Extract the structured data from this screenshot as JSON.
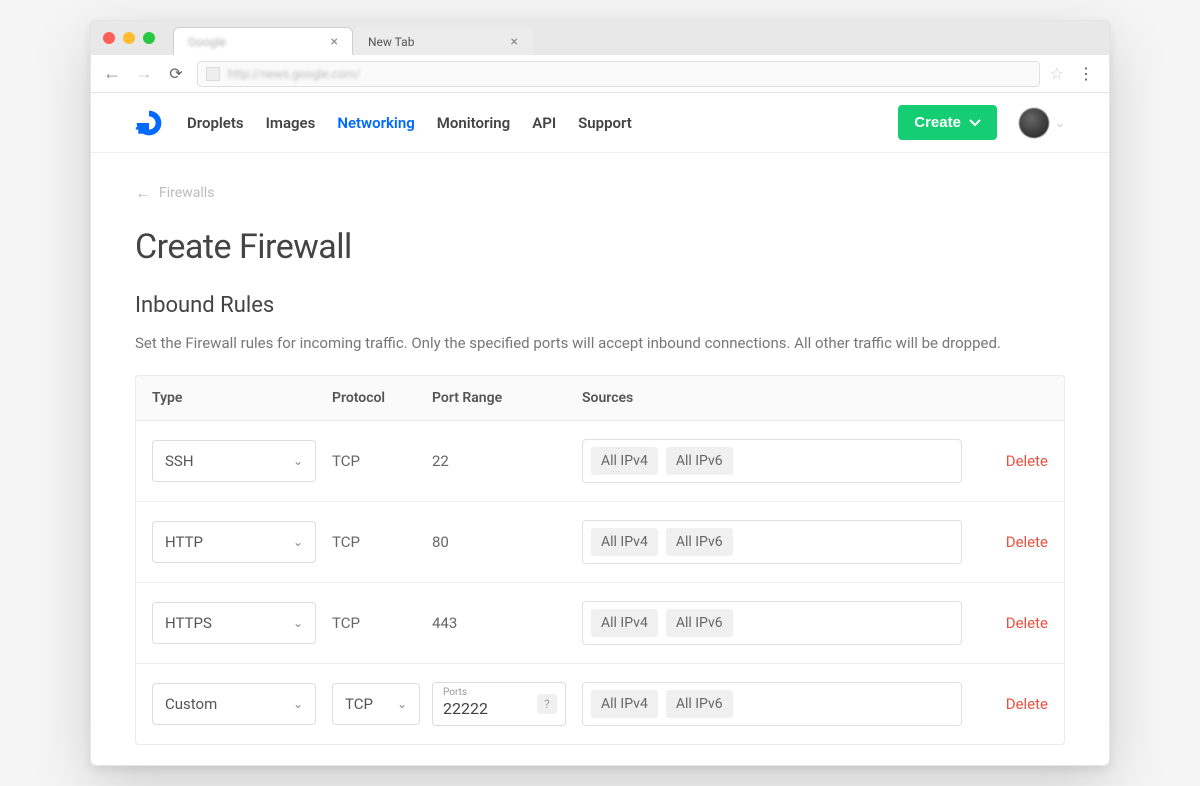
{
  "browser": {
    "tabs": [
      {
        "title": "Google",
        "blurred": true
      },
      {
        "title": "New Tab",
        "blurred": false
      }
    ],
    "url": "http://news.google.com/"
  },
  "nav": {
    "items": [
      "Droplets",
      "Images",
      "Networking",
      "Monitoring",
      "API",
      "Support"
    ],
    "active": "Networking",
    "create_label": "Create"
  },
  "breadcrumb": {
    "label": "Firewalls"
  },
  "page": {
    "title": "Create Firewall",
    "section_title": "Inbound Rules",
    "section_desc": "Set the Firewall rules for incoming traffic. Only the specified ports will accept inbound connections. All other traffic will be dropped."
  },
  "table": {
    "headers": {
      "type": "Type",
      "protocol": "Protocol",
      "port": "Port Range",
      "sources": "Sources"
    },
    "delete_label": "Delete",
    "rows": [
      {
        "type": "SSH",
        "protocol": "TCP",
        "protocol_select": false,
        "port": "22",
        "port_input": false,
        "sources": [
          "All IPv4",
          "All IPv6"
        ]
      },
      {
        "type": "HTTP",
        "protocol": "TCP",
        "protocol_select": false,
        "port": "80",
        "port_input": false,
        "sources": [
          "All IPv4",
          "All IPv6"
        ]
      },
      {
        "type": "HTTPS",
        "protocol": "TCP",
        "protocol_select": false,
        "port": "443",
        "port_input": false,
        "sources": [
          "All IPv4",
          "All IPv6"
        ]
      },
      {
        "type": "Custom",
        "protocol": "TCP",
        "protocol_select": true,
        "port": "22222",
        "port_label": "Ports",
        "port_input": true,
        "sources": [
          "All IPv4",
          "All IPv6"
        ]
      }
    ]
  }
}
